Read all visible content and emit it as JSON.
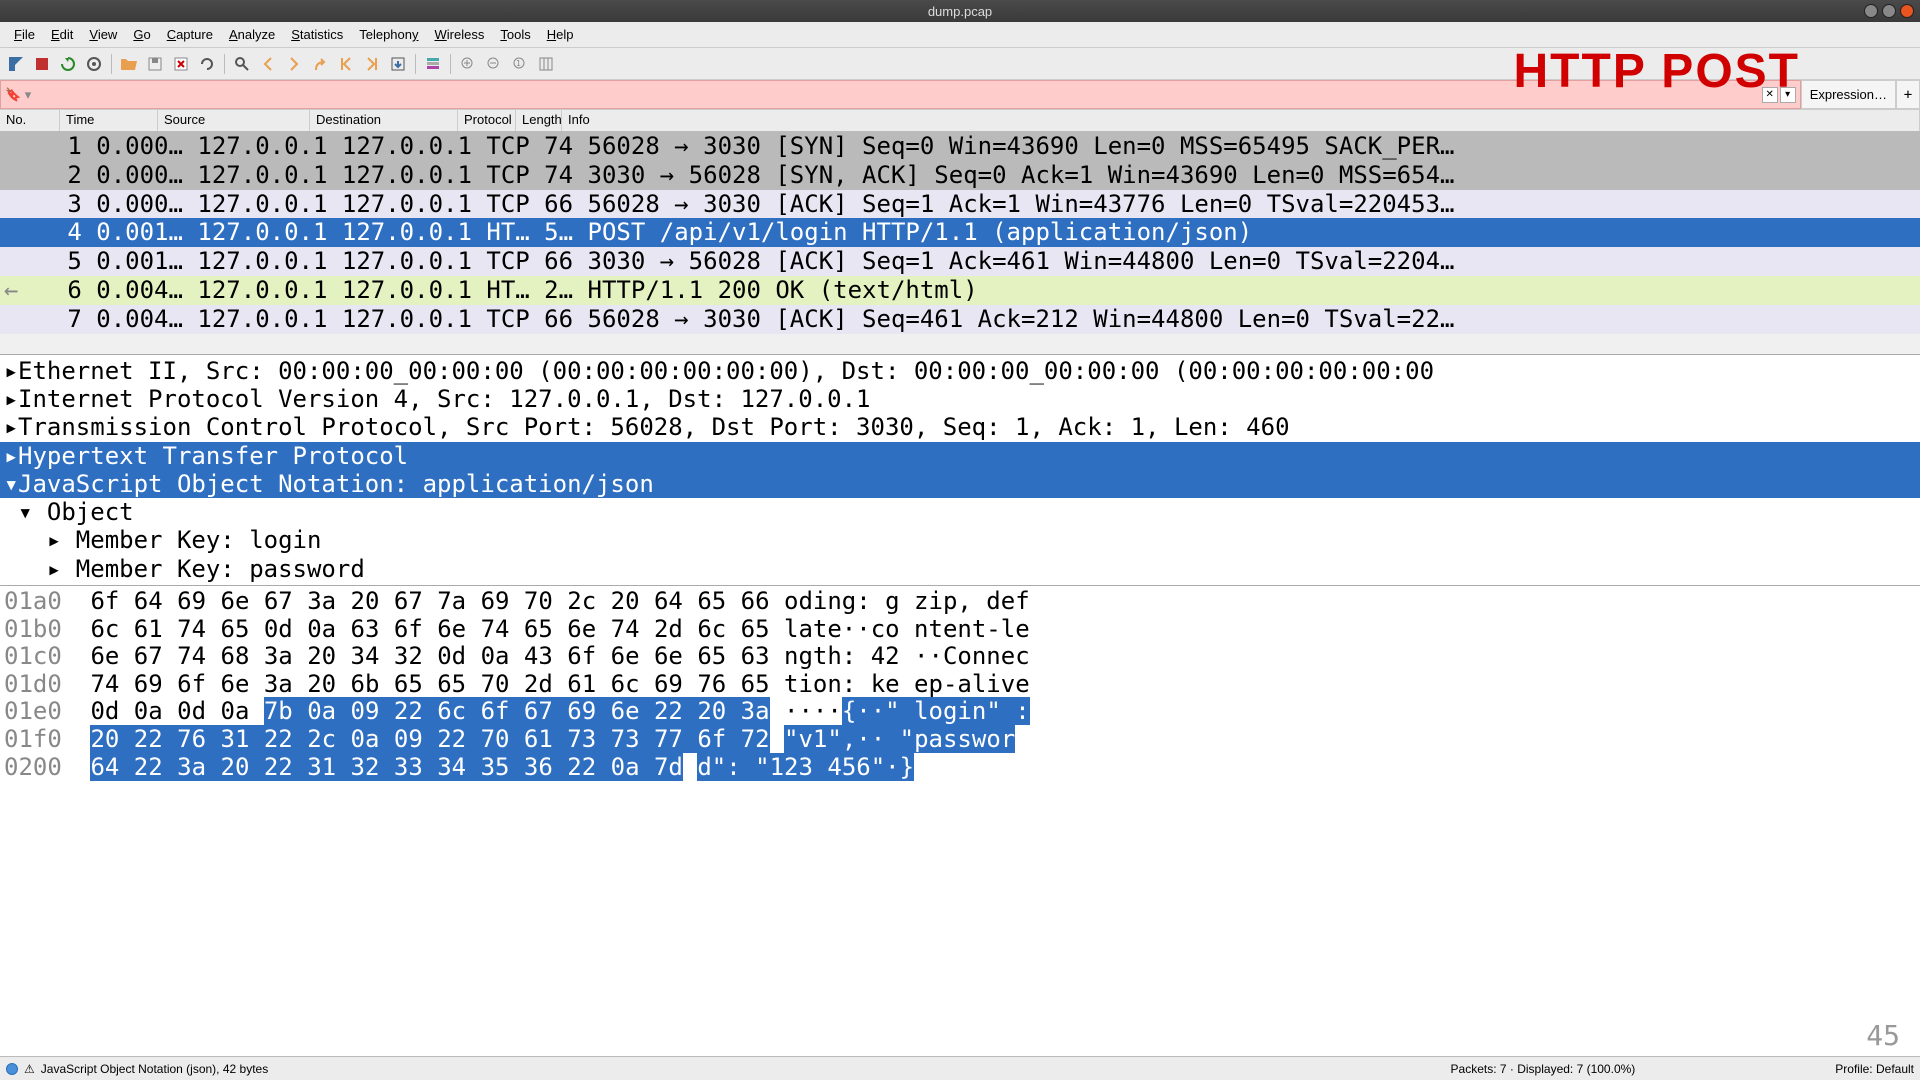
{
  "window": {
    "title": "dump.pcap"
  },
  "annotation": "HTTP POST",
  "menu": {
    "file": "File",
    "edit": "Edit",
    "view": "View",
    "go": "Go",
    "capture": "Capture",
    "analyze": "Analyze",
    "statistics": "Statistics",
    "telephony": "Telephony",
    "wireless": "Wireless",
    "tools": "Tools",
    "help": "Help"
  },
  "filter": {
    "expression_label": "Expression…"
  },
  "columns": {
    "no": "No.",
    "time": "Time",
    "source": "Source",
    "destination": "Destination",
    "protocol": "Protocol",
    "length": "Length",
    "info": "Info"
  },
  "packets": [
    {
      "no": "1",
      "time": "0.000…",
      "src": "127.0.0.1",
      "dst": "127.0.0.1",
      "proto": "TCP",
      "len": "74",
      "info": "56028 → 3030 [SYN] Seq=0 Win=43690 Len=0 MSS=65495 SACK_PER…",
      "cls": "gray"
    },
    {
      "no": "2",
      "time": "0.000…",
      "src": "127.0.0.1",
      "dst": "127.0.0.1",
      "proto": "TCP",
      "len": "74",
      "info": "3030 → 56028 [SYN, ACK] Seq=0 Ack=1 Win=43690 Len=0 MSS=654…",
      "cls": "gray"
    },
    {
      "no": "3",
      "time": "0.000…",
      "src": "127.0.0.1",
      "dst": "127.0.0.1",
      "proto": "TCP",
      "len": "66",
      "info": "56028 → 3030 [ACK] Seq=1 Ack=1 Win=43776 Len=0 TSval=220453…",
      "cls": "lavender"
    },
    {
      "no": "4",
      "time": "0.001…",
      "src": "127.0.0.1",
      "dst": "127.0.0.1",
      "proto": "HT…",
      "len": "5…",
      "info": "POST /api/v1/login HTTP/1.1  (application/json)",
      "cls": "selected"
    },
    {
      "no": "5",
      "time": "0.001…",
      "src": "127.0.0.1",
      "dst": "127.0.0.1",
      "proto": "TCP",
      "len": "66",
      "info": "3030 → 56028 [ACK] Seq=1 Ack=461 Win=44800 Len=0 TSval=2204…",
      "cls": "lavender"
    },
    {
      "no": "6",
      "time": "0.004…",
      "src": "127.0.0.1",
      "dst": "127.0.0.1",
      "proto": "HT…",
      "len": "2…",
      "info": "HTTP/1.1 200 OK  (text/html)",
      "cls": "green"
    },
    {
      "no": "7",
      "time": "0.004…",
      "src": "127.0.0.1",
      "dst": "127.0.0.1",
      "proto": "TCP",
      "len": "66",
      "info": "56028 → 3030 [ACK] Seq=461 Ack=212 Win=44800 Len=0 TSval=22…",
      "cls": "lavender"
    }
  ],
  "details": {
    "eth": "Ethernet II, Src: 00:00:00_00:00:00 (00:00:00:00:00:00), Dst: 00:00:00_00:00:00 (00:00:00:00:00:00",
    "ip": "Internet Protocol Version 4, Src: 127.0.0.1, Dst: 127.0.0.1",
    "tcp": "Transmission Control Protocol, Src Port: 56028, Dst Port: 3030, Seq: 1, Ack: 1, Len: 460",
    "http": "Hypertext Transfer Protocol",
    "json": "JavaScript Object Notation: application/json",
    "obj": "Object",
    "mk1": "Member Key: login",
    "mk2": "Member Key: password"
  },
  "hex": [
    {
      "off": "01a0",
      "b": "6f 64 69 6e 67 3a 20 67  7a 69 70 2c 20 64 65 66",
      "a": "oding: g zip, def"
    },
    {
      "off": "01b0",
      "b": "6c 61 74 65 0d 0a 63 6f  6e 74 65 6e 74 2d 6c 65",
      "a": "late··co ntent-le"
    },
    {
      "off": "01c0",
      "b": "6e 67 74 68 3a 20 34 32  0d 0a 43 6f 6e 6e 65 63",
      "a": "ngth: 42 ··Connec"
    },
    {
      "off": "01d0",
      "b": "74 69 6f 6e 3a 20 6b 65  65 70 2d 61 6c 69 76 65",
      "a": "tion: ke ep-alive"
    }
  ],
  "hexsel": [
    {
      "off": "01e0",
      "pre_b": "0d 0a 0d 0a ",
      "sel_b": "7b 0a 09 22  6c 6f 67 69 6e 22 20 3a",
      "pre_a": "····",
      "sel_a": "{··\" login\" :"
    },
    {
      "off": "01f0",
      "pre_b": "",
      "sel_b": "20 22 76 31 22 2c 0a 09  22 70 61 73 73 77 6f 72",
      "pre_a": "",
      "sel_a": " \"v1\",·· \"passwor"
    },
    {
      "off": "0200",
      "pre_b": "",
      "sel_b": "64 22 3a 20 22 31 32 33  34 35 36 22 0a 7d",
      "pre_a": "",
      "sel_a": "d\": \"123 456\"·}"
    }
  ],
  "status": {
    "left": "JavaScript Object Notation (json), 42 bytes",
    "mid": "Packets: 7 · Displayed: 7 (100.0%)",
    "right": "Profile: Default"
  },
  "pagenum": "45"
}
